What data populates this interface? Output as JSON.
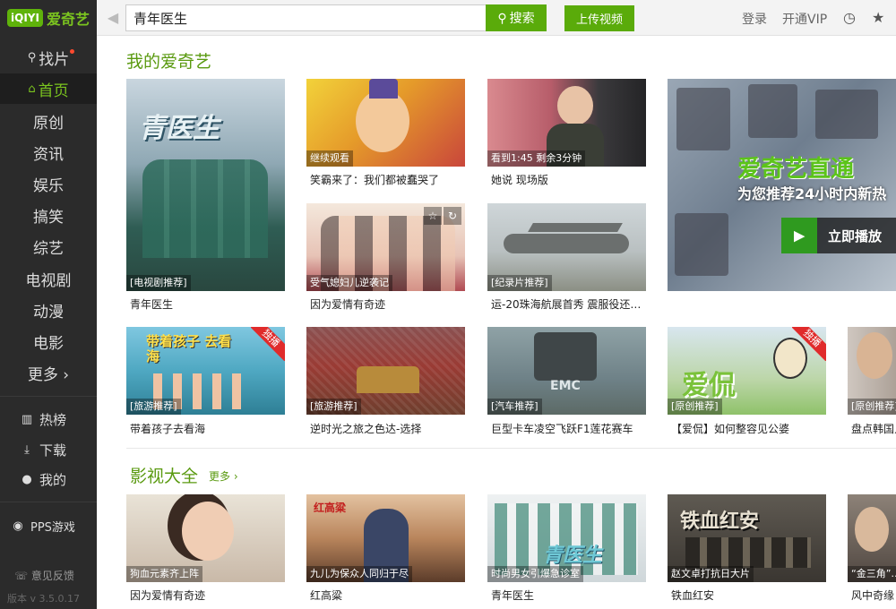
{
  "app": {
    "logo_mark": "iQIYI",
    "logo_name": "爱奇艺",
    "version": "版本 v 3.5.0.17",
    "feedback": "意见反馈"
  },
  "sidebar": {
    "items": [
      {
        "label": "找片",
        "icon": "search-icon"
      },
      {
        "label": "首页",
        "icon": "home-icon",
        "active": true
      },
      {
        "label": "原创"
      },
      {
        "label": "资讯"
      },
      {
        "label": "娱乐"
      },
      {
        "label": "搞笑"
      },
      {
        "label": "综艺"
      },
      {
        "label": "电视剧"
      },
      {
        "label": "动漫"
      },
      {
        "label": "电影"
      },
      {
        "label": "更多 ›"
      }
    ],
    "tools": [
      {
        "label": "热榜",
        "icon": "bar-chart-icon"
      },
      {
        "label": "下载",
        "icon": "download-icon"
      },
      {
        "label": "我的",
        "icon": "user-icon"
      }
    ],
    "games": {
      "label": "PPS游戏",
      "icon": "game-icon"
    }
  },
  "topbar": {
    "search_value": "青年医生",
    "search_button": "搜索",
    "upload_button": "上传视频",
    "login": "登录",
    "vip": "开通VIP"
  },
  "sections": {
    "mine": "我的爱奇艺",
    "films": "影视大全",
    "films_more": "更多 ›"
  },
  "cards_row1": [
    {
      "caption": "[电视剧推荐]",
      "title": "青年医生",
      "deco": "青医生"
    },
    {
      "caption": "继续观看",
      "title": "笑霸来了：我们都被蠢哭了"
    },
    {
      "caption": "看到1:45 剩余3分钟",
      "title": "她说 现场版"
    },
    {
      "caption": "受气媳妇儿逆袭记",
      "title": "因为爱情有奇迹"
    },
    {
      "caption": "[纪录片推荐]",
      "title": "运-20珠海航展首秀 震服役还…"
    }
  ],
  "cards_row2": [
    {
      "caption": "[旅游推荐]",
      "title": "带着孩子去看海",
      "deco": "带着孩子 去看海",
      "excl": "独播"
    },
    {
      "caption": "[旅游推荐]",
      "title": "逆时光之旅之色达-选择"
    },
    {
      "caption": "[汽车推荐]",
      "title": "巨型卡车凌空飞跃F1莲花赛车",
      "deco": "EMC"
    },
    {
      "caption": "[原创推荐]",
      "title": "【爱侃】如何整容见公婆",
      "deco": "爱侃",
      "excl": "独播"
    },
    {
      "caption": "[原创推荐]",
      "title": "盘点韩国人…"
    }
  ],
  "cards_row3": [
    {
      "caption": "狗血元素齐上阵",
      "title": "因为爱情有奇迹"
    },
    {
      "caption": "九儿为保众人同归于尽",
      "title": "红高粱",
      "deco": "红高粱"
    },
    {
      "caption": "时尚男女引爆急诊室",
      "title": "青年医生",
      "deco": "青医生"
    },
    {
      "caption": "赵文卓打抗日大片",
      "title": "铁血红安",
      "deco": "铁血红安"
    },
    {
      "caption": "“金三角”…",
      "title": "风中奇缘"
    }
  ],
  "live": {
    "title": "爱奇艺直通",
    "subtitle": "为您推荐24小时内新热",
    "play": "立即播放"
  },
  "colors": {
    "accent": "#5aab0a",
    "sidebar": "#2b2b2b",
    "badge": "#e02b2b"
  }
}
